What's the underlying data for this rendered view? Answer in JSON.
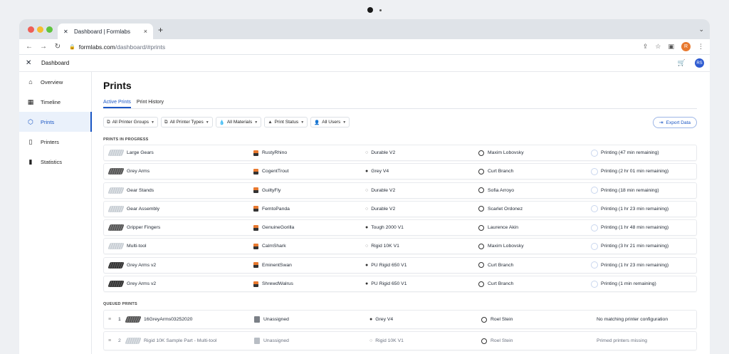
{
  "browser": {
    "tab_title": "Dashboard | Formlabs",
    "url_host": "formlabs.com",
    "url_path": "/dashboard/#prints",
    "profile_initial": "R"
  },
  "app": {
    "name": "Dashboard",
    "user_initials": "RS"
  },
  "sidebar": {
    "items": [
      {
        "label": "Overview",
        "icon": "home-icon"
      },
      {
        "label": "Timeline",
        "icon": "calendar-icon"
      },
      {
        "label": "Prints",
        "icon": "cube-icon",
        "active": true
      },
      {
        "label": "Printers",
        "icon": "printer-icon"
      },
      {
        "label": "Statistics",
        "icon": "bar-chart-icon"
      }
    ]
  },
  "page": {
    "title": "Prints",
    "tabs": [
      {
        "label": "Active Prints",
        "active": true
      },
      {
        "label": "Print History",
        "active": false
      }
    ],
    "filters": [
      {
        "label": "All Printer Groups",
        "icon": "printer-group-icon"
      },
      {
        "label": "All Printer Types",
        "icon": "printer-type-icon"
      },
      {
        "label": "All Materials",
        "icon": "drop-icon"
      },
      {
        "label": "Print Status",
        "icon": "warning-icon"
      },
      {
        "label": "All Users",
        "icon": "user-icon"
      }
    ],
    "export_label": "Export Data",
    "in_progress_heading": "PRINTS IN PROGRESS",
    "queued_heading": "QUEUED PRINTS"
  },
  "in_progress": [
    {
      "name": "Large Gears",
      "thumb": "light",
      "printer": "RustyRhino",
      "material": "Durable V2",
      "material_filled": false,
      "user": "Maxim Lobovsky",
      "status": "Printing (47 min remaining)"
    },
    {
      "name": "Grey Arms",
      "thumb": "grey",
      "printer": "CogentTrout",
      "material": "Grey V4",
      "material_filled": true,
      "user": "Curt Branch",
      "status": "Printing (2 hr 01 min remaining)"
    },
    {
      "name": "Gear Stands",
      "thumb": "light",
      "printer": "GuiltyFly",
      "material": "Durable V2",
      "material_filled": false,
      "user": "Sofia Arroyo",
      "status": "Printing (18 min remaining)"
    },
    {
      "name": "Gear Assembly",
      "thumb": "light",
      "printer": "FemtoPanda",
      "material": "Durable V2",
      "material_filled": false,
      "user": "Scarlet Ordonez",
      "status": "Printing (1 hr 23 min remaining)"
    },
    {
      "name": "Gripper Fingers",
      "thumb": "grey",
      "printer": "GenuineGorilla",
      "material": "Tough 2000 V1",
      "material_filled": true,
      "user": "Laurence Akin",
      "status": "Printing (1 hr 48 min remaining)"
    },
    {
      "name": "Multi-tool",
      "thumb": "light",
      "printer": "CalmShark",
      "material": "Rigid 10K V1",
      "material_filled": false,
      "user": "Maxim Lobovsky",
      "status": "Printing (3 hr 21 min remaining)"
    },
    {
      "name": "Grey Arms v2",
      "thumb": "dark",
      "printer": "EminentSwan",
      "material": "PU Rigid 650 V1",
      "material_filled": true,
      "user": "Curt Branch",
      "status": "Printing (1 hr 23 min remaining)"
    },
    {
      "name": "Grey Arms v2",
      "thumb": "dark",
      "printer": "ShrewdWalrus",
      "material": "PU Rigid 650 V1",
      "material_filled": true,
      "user": "Curt Branch",
      "status": "Printing (1 min remaining)"
    }
  ],
  "queued": [
    {
      "num": "1",
      "name": "16GreyArms03252020",
      "thumb": "grey",
      "printer": "Unassigned",
      "material": "Grey V4",
      "material_filled": true,
      "user": "Roel Stein",
      "status": "No matching printer configuration",
      "dim": false
    },
    {
      "num": "2",
      "name": "Rigid 10K Sample Part - Multi-tool",
      "thumb": "light",
      "printer": "Unassigned",
      "material": "Rigid 10K V1",
      "material_filled": false,
      "user": "Roel Stein",
      "status": "Primed printers missing",
      "dim": true
    }
  ]
}
